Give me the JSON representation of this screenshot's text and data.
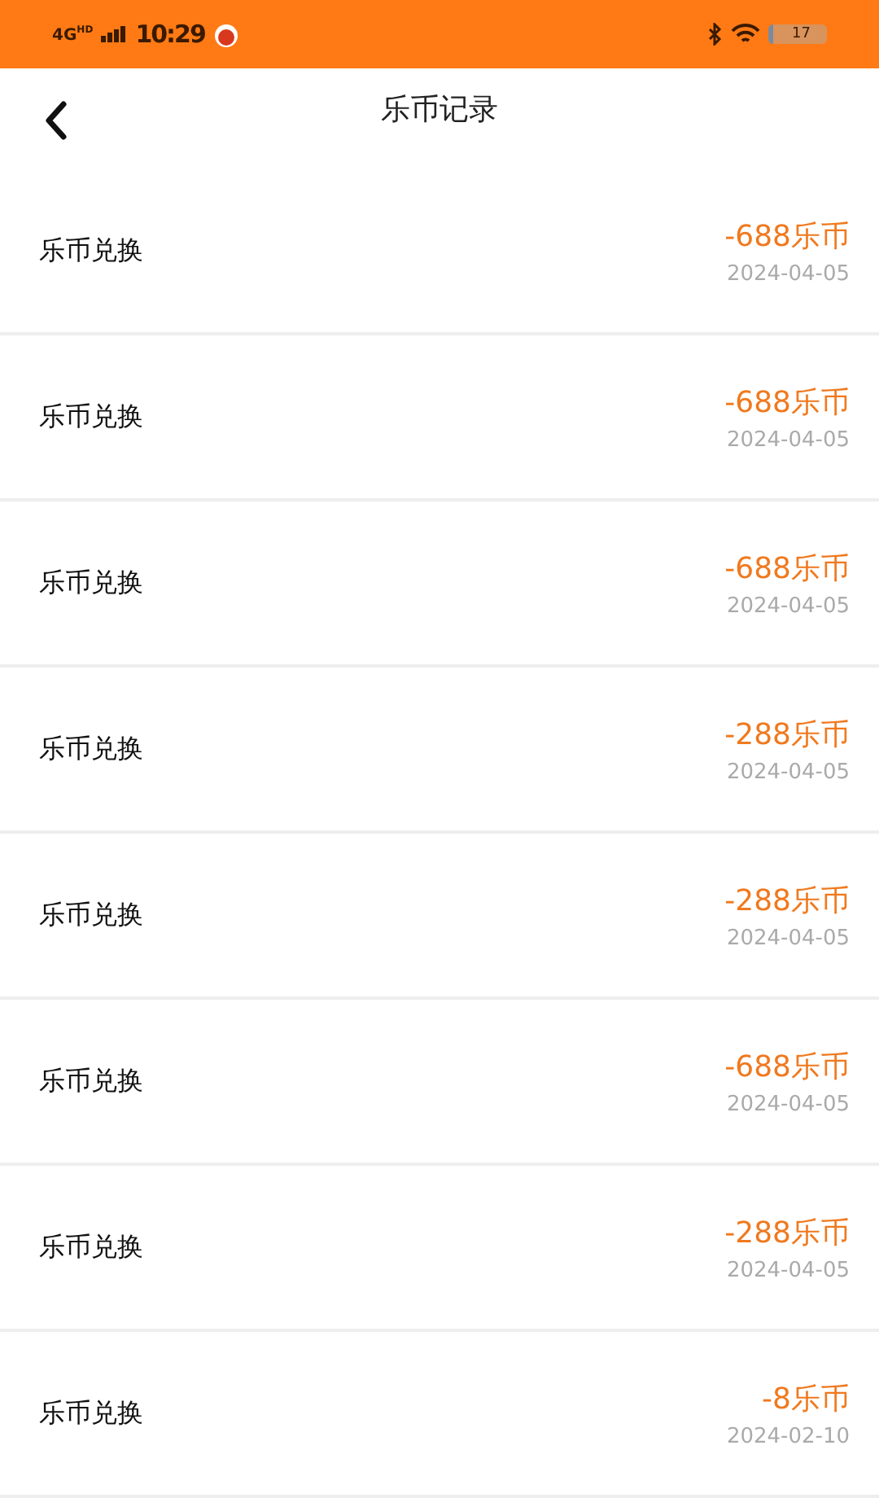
{
  "status_bar": {
    "network": "4G",
    "network_badge": "HD",
    "time": "10:29",
    "battery": "17"
  },
  "header": {
    "title": "乐币记录"
  },
  "records": [
    {
      "label": "乐币兑换",
      "amount": "-688乐币",
      "date": "2024-04-05"
    },
    {
      "label": "乐币兑换",
      "amount": "-688乐币",
      "date": "2024-04-05"
    },
    {
      "label": "乐币兑换",
      "amount": "-688乐币",
      "date": "2024-04-05"
    },
    {
      "label": "乐币兑换",
      "amount": "-288乐币",
      "date": "2024-04-05"
    },
    {
      "label": "乐币兑换",
      "amount": "-288乐币",
      "date": "2024-04-05"
    },
    {
      "label": "乐币兑换",
      "amount": "-688乐币",
      "date": "2024-04-05"
    },
    {
      "label": "乐币兑换",
      "amount": "-288乐币",
      "date": "2024-04-05"
    },
    {
      "label": "乐币兑换",
      "amount": "-8乐币",
      "date": "2024-02-10"
    }
  ]
}
